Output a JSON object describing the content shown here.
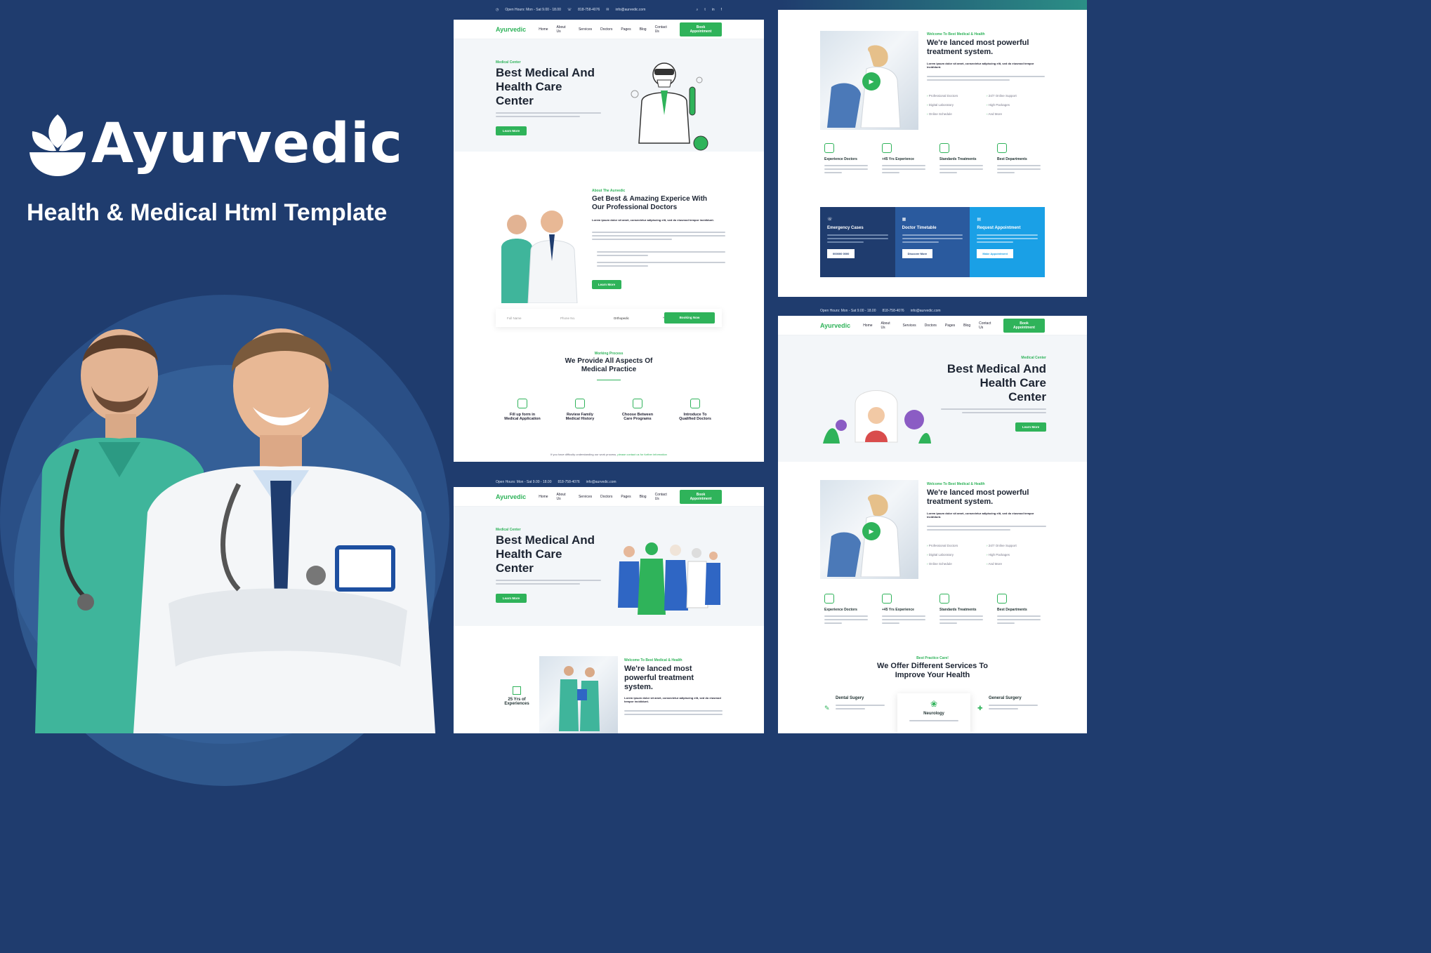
{
  "brand": {
    "logo": "Ayurvedic",
    "tagline": "Health & Medical Html Template"
  },
  "colors": {
    "navy": "#1f3c6e",
    "green": "#2fb35a",
    "blue": "#1aa0e6",
    "white": "#ffffff"
  },
  "topbar": {
    "hours": "Open Hours: Mon - Sat 9.00 - 18.00",
    "phone": "818-758-4076",
    "email": "info@aurvedic.com"
  },
  "nav": {
    "items": [
      "Home",
      "About Us",
      "Services",
      "Doctors",
      "Pages",
      "Blog",
      "Contact Us"
    ],
    "cta": "Book Appointment"
  },
  "hero": {
    "eyebrow": "Medical Center",
    "title_l1": "Best Medical And",
    "title_l2": "Health Care",
    "title_l3": "Center",
    "button": "Learn More"
  },
  "about": {
    "eyebrow": "About The Aurvedic",
    "title_l1": "Get Best & Amazing Experice With",
    "title_l2": "Our Professional Doctors",
    "lead": "Lorem ipsum dolor sit amet, consectetur adipiscing elit, sed do eiusmod tempor incididunt.",
    "button": "Learn More"
  },
  "booking": {
    "name": "Full Name",
    "phone": "Phone No.",
    "dept": "Orthopedic",
    "button": "Booking Now"
  },
  "process": {
    "eyebrow": "Working Process",
    "title_l1": "We Provide All Aspects Of",
    "title_l2": "Medical Practice",
    "steps": [
      {
        "l1": "Fill up form in",
        "l2": "Medical Application"
      },
      {
        "l1": "Review Family",
        "l2": "Medical History"
      },
      {
        "l1": "Choose Between",
        "l2": "Care Programs"
      },
      {
        "l1": "Introduce To",
        "l2": "Qualified Doctors"
      }
    ],
    "note": "If you have difficulty understanding our work process,",
    "note_link": "please contact us for further information"
  },
  "welcome": {
    "eyebrow": "Welcome To Best Medical & Health",
    "title_l1": "We're lanced most powerful",
    "title_l2": "treatment system.",
    "lead": "Lorem ipsum dolor sit amet, consectetur adipiscing elit, sed do eiusmod tempor incididunt.",
    "list": [
      "Professional Doctors",
      "24/7 Online Support",
      "Digital Laboratory",
      "High Packages",
      "Online Schedule",
      "And More"
    ]
  },
  "features": [
    "Experience Doctors",
    "+45 Yrs Experience",
    "Standards Treatments",
    "Best Departments"
  ],
  "info_boxes": [
    {
      "title": "Emergency Cases",
      "button": "000000 0000"
    },
    {
      "title": "Doctor Timetable",
      "button": "Discover More"
    },
    {
      "title": "Request Appointment",
      "button": "Make Appointment"
    }
  ],
  "experience": {
    "years_l1": "25 Yrs of",
    "years_l2": "Experiences"
  },
  "welcome3": {
    "title_l1": "We're lanced most",
    "title_l2": "powerful treatment",
    "title_l3": "system."
  },
  "services": {
    "eyebrow": "Best Practice Care!",
    "title_l1": "We Offer Different Services To",
    "title_l2": "Improve Your Health",
    "items": [
      "Dental Sugery",
      "Neurology",
      "General Surgery"
    ]
  }
}
